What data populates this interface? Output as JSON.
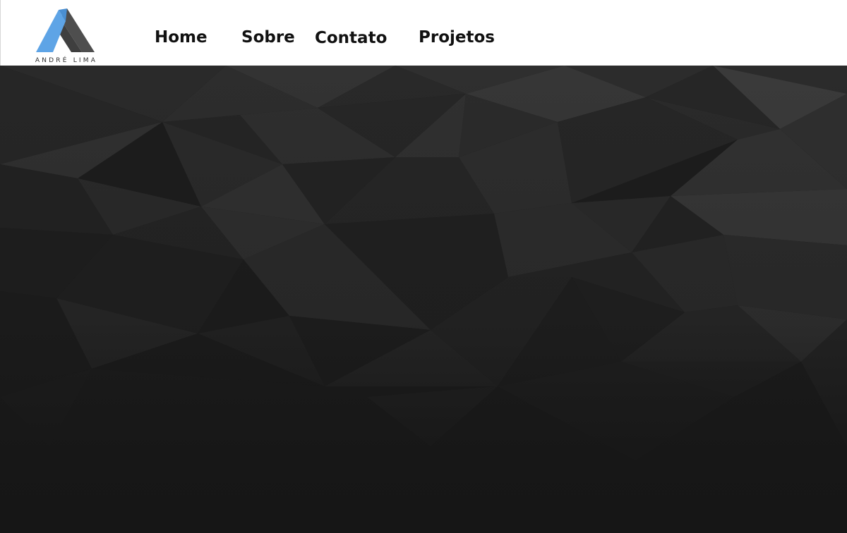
{
  "brand": {
    "name": "ANDRÉ LIMA",
    "logo_colors": {
      "left_facet": "#5ea4e6",
      "right_facet": "#4b4b4b",
      "top_facet": "#5a5a5a"
    }
  },
  "nav": {
    "items": [
      {
        "label": "Home"
      },
      {
        "label": "Sobre"
      },
      {
        "label": "Contato"
      },
      {
        "label": "Projetos"
      }
    ]
  },
  "hero": {
    "background": "dark-low-poly-pattern",
    "base_color": "#161616"
  }
}
